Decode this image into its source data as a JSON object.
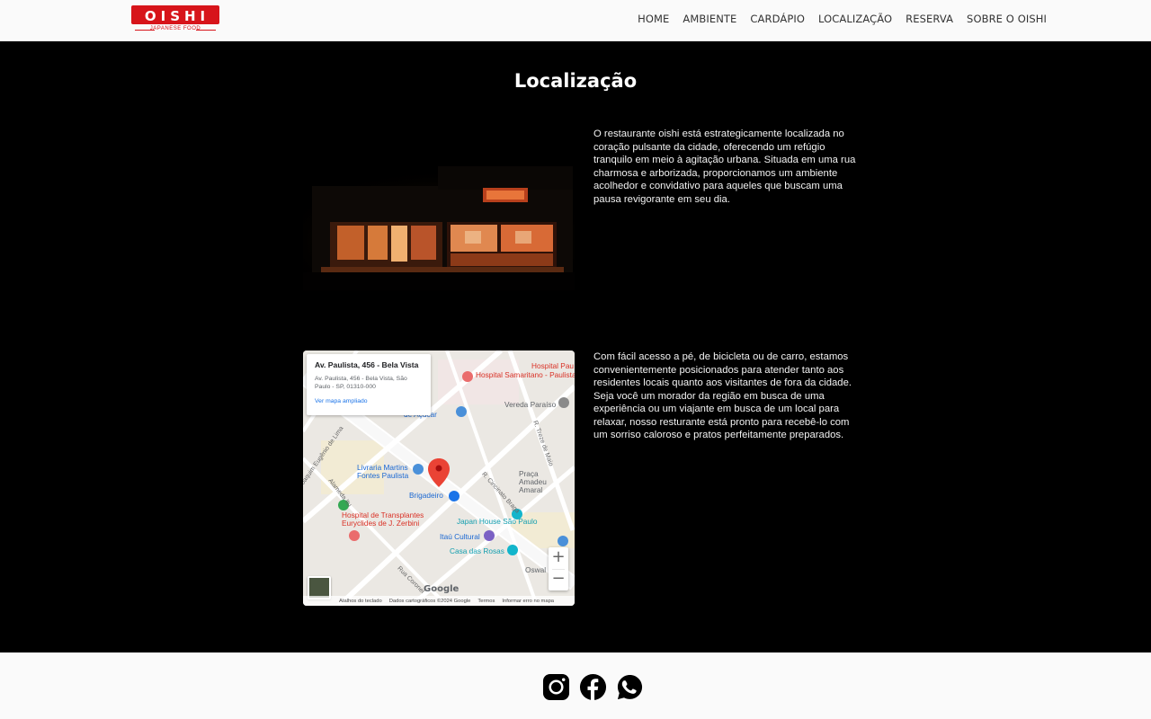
{
  "brand": {
    "logo_text": "OISHI",
    "logo_sub": "JAPANESE FOOD"
  },
  "nav": [
    "HOME",
    "AMBIENTE",
    "CARDÁPIO",
    "LOCALIZAÇÃO",
    "RESERVA",
    "SOBRE O OISHI"
  ],
  "section": {
    "title": "Localização",
    "paragraph1": "O restaurante oishi está estrategicamente localizada no coração pulsante da cidade, oferecendo um refúgio tranquilo em meio à agitação urbana. Situada em uma rua charmosa e arborizada, proporcionamos um ambiente acolhedor e convidativo para aqueles que buscam uma pausa revigorante em seu dia.",
    "paragraph2": "Com fácil acesso a pé, de bicicleta ou de carro, estamos convenientemente posicionados para atender tanto aos residentes locais quanto aos visitantes de fora da cidade. Seja você um morador da região em busca de uma experiência ou um viajante em busca de um local para relaxar, nosso resturante está pronto para recebê-lo com um sorriso caloroso e pratos perfeitamente preparados."
  },
  "map": {
    "card_title": "Av. Paulista, 456 - Bela Vista",
    "card_address": "Av. Paulista, 456 - Bela Vista, São Paulo - SP, 01310-000",
    "card_link": "Ver mapa ampliado",
    "places": {
      "hospital_samaritano": "Hospital Samaritano - Paulista",
      "hospital_pau": "Hospital Pau",
      "acucar": "de Açúcar",
      "vereda": "Vereda Paraíso",
      "livraria": "Livraria Martins Fontes Paulista",
      "brigadeiro": "Brigadeiro",
      "praca": "Praça Amadeu Amaral",
      "hospital_transplantes": "Hospital de Transplantes Euryclides de J. Zerbini",
      "japan_house": "Japan House São Paulo",
      "itau": "Itaú Cultural",
      "casa_rosas": "Casa das Rosas",
      "oswal": "Oswal"
    },
    "roads": {
      "treze_maio": "R. Treze de Maio",
      "cincinato": "R. Cincinato Braga",
      "eugenio": "Joaquim Eugênio de Lima",
      "itu": "Alameda Itu",
      "coronel": "Rua Coronel"
    },
    "google": "Google",
    "attribution": [
      "Atalhos do teclado",
      "Dados cartográficos ©2024 Google",
      "Termos",
      "Informar erro no mapa"
    ],
    "zoom_in": "+",
    "zoom_out": "−"
  },
  "footer": {
    "icons": [
      "instagram-icon",
      "facebook-icon",
      "whatsapp-icon"
    ]
  },
  "colors": {
    "brand_red": "#d7141a",
    "background": "#000000",
    "header_bg": "#fafafa"
  }
}
